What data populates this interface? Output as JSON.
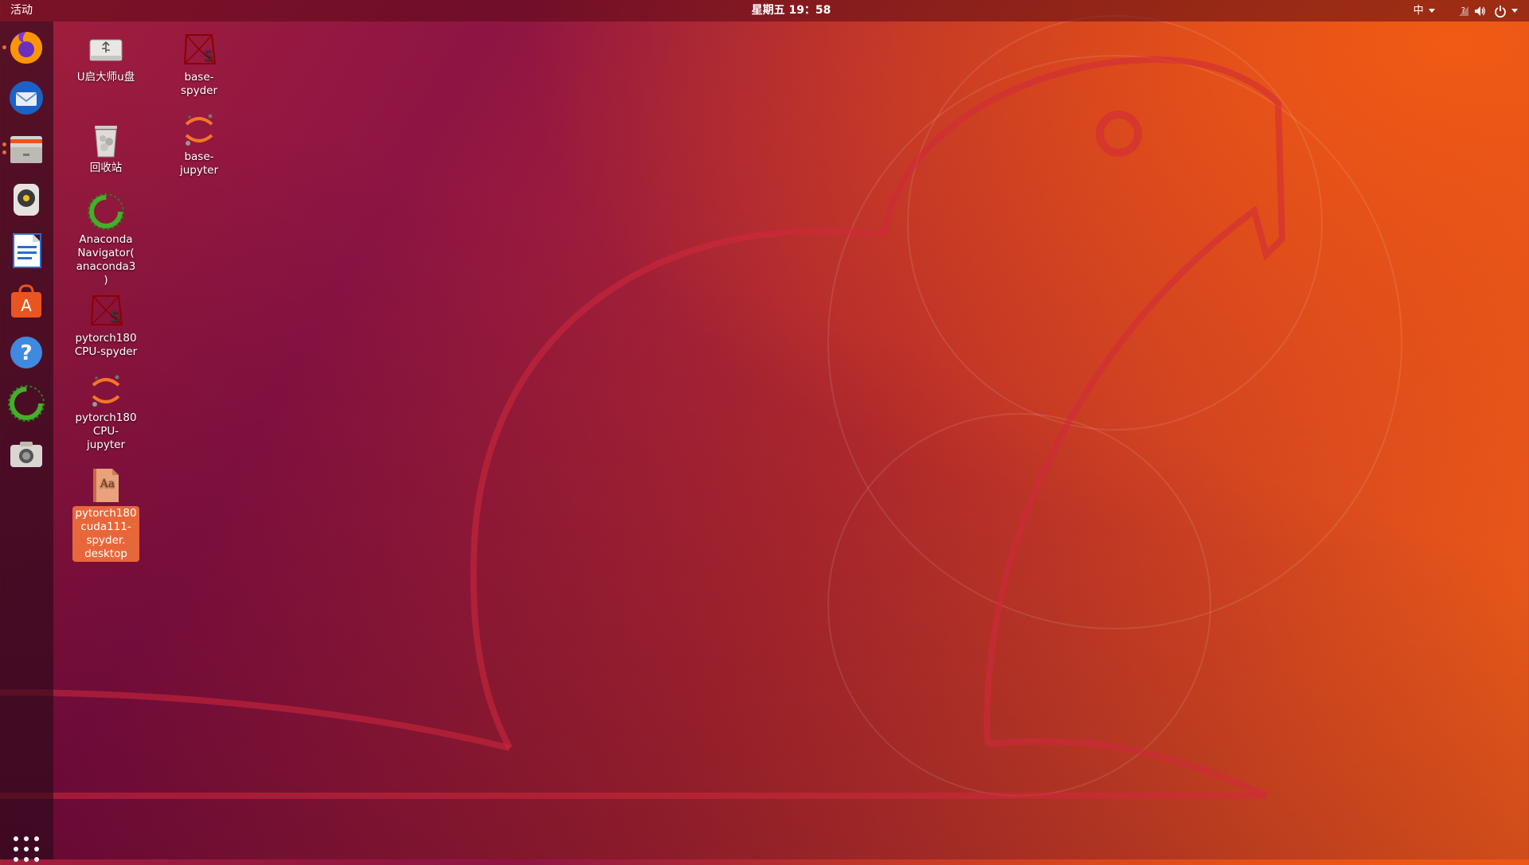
{
  "topbar": {
    "activities": "活动",
    "clock": "星期五 19：58",
    "input_method": "中",
    "network_status": "?"
  },
  "dock": {
    "items": [
      {
        "icon": "firefox-icon",
        "running": true
      },
      {
        "icon": "thunderbird-icon",
        "running": false
      },
      {
        "icon": "files-icon",
        "running": true
      },
      {
        "icon": "rhythmbox-icon",
        "running": false
      },
      {
        "icon": "libreoffice-writer-icon",
        "running": false
      },
      {
        "icon": "software-center-icon",
        "running": false
      },
      {
        "icon": "help-icon",
        "running": false
      },
      {
        "icon": "anaconda-icon",
        "running": false
      },
      {
        "icon": "screenshot-icon",
        "running": false
      }
    ],
    "show_apps_icon": "app-grid-icon"
  },
  "desktop": {
    "icons": [
      {
        "label": "U启大师u盘",
        "icon": "usb-drive-icon"
      },
      {
        "label": "回收站",
        "icon": "trash-icon"
      },
      {
        "label": "Anaconda Navigator( anaconda3)",
        "icon": "anaconda-icon"
      },
      {
        "label": "pytorch180 CPU-spyder",
        "icon": "spyder-icon"
      },
      {
        "label": "pytorch180 CPU- jupyter",
        "icon": "jupyter-icon"
      },
      {
        "label": "pytorch180 cuda111- spyder. desktop",
        "icon": "desktop-file-icon",
        "selected": true
      },
      {
        "label": "base- spyder",
        "icon": "spyder-icon"
      },
      {
        "label": "base- jupyter",
        "icon": "jupyter-icon"
      }
    ]
  },
  "colors": {
    "accent": "#e8673a",
    "running_dot": "#f16a2c",
    "anaconda_green": "#43b02a",
    "spyder_red": "#8c0000",
    "jupyter_orange": "#f37726"
  }
}
